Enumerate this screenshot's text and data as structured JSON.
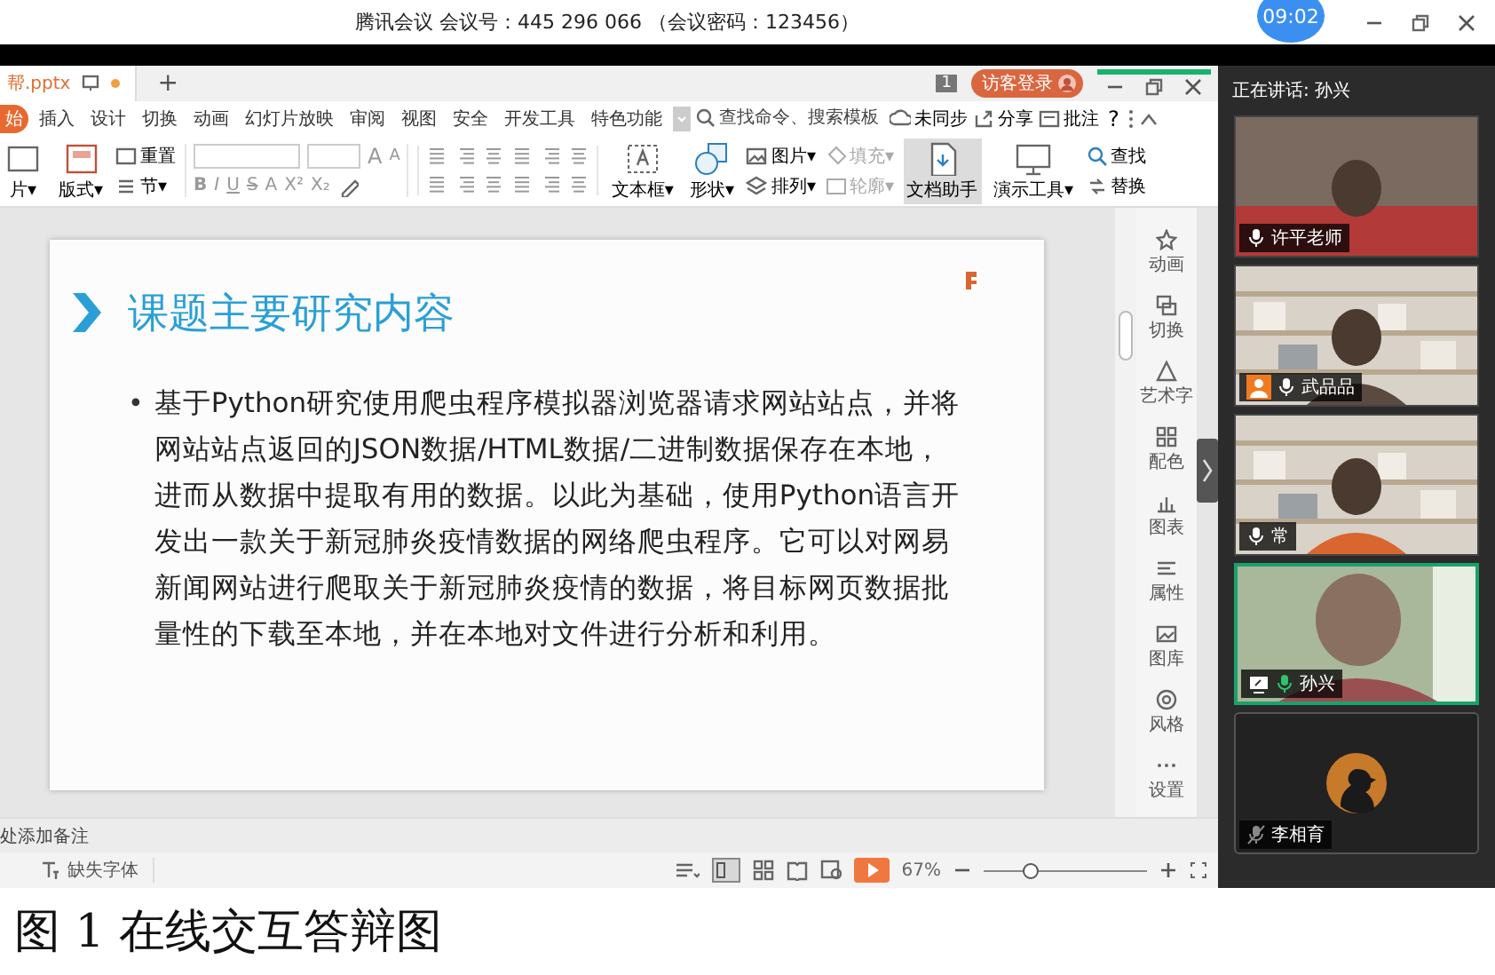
{
  "meeting_bar": {
    "title": "腾讯会议  会议号：445 296 066  （会议密码：123456）",
    "timer": "09:02"
  },
  "document_tabs": [
    {
      "label": "帮.pptx",
      "selected": true
    }
  ],
  "new_tab": "+",
  "page_count": "1",
  "login_button": "访客登录",
  "menu": [
    {
      "label": "始",
      "selected": true
    },
    {
      "label": "插入",
      "selected": false
    },
    {
      "label": "设计",
      "selected": false
    },
    {
      "label": "切换",
      "selected": false
    },
    {
      "label": "动画",
      "selected": false
    },
    {
      "label": "幻灯片放映",
      "selected": false
    },
    {
      "label": "审阅",
      "selected": false
    },
    {
      "label": "视图",
      "selected": false
    },
    {
      "label": "安全",
      "selected": false
    },
    {
      "label": "开发工具",
      "selected": false
    },
    {
      "label": "特色功能",
      "selected": false
    }
  ],
  "search": {
    "placeholder": "查找命令、搜索模板"
  },
  "menu_actions": [
    "未同步",
    "分享",
    "批注"
  ],
  "help": "?",
  "ribbon": [
    {
      "kind": "big",
      "label": "片▾",
      "selected": false
    },
    {
      "kind": "big",
      "label": "版式▾",
      "selected": false
    },
    {
      "kind": "stack",
      "items": [
        {
          "label": "重置",
          "disabled": false
        },
        {
          "label": "节▾",
          "disabled": false
        }
      ]
    },
    {
      "kind": "font",
      "size_buttons": [
        "A",
        "A"
      ],
      "format_buttons": [
        "B",
        "I",
        "U",
        "S",
        "A",
        "X²",
        "X₂"
      ]
    },
    {
      "kind": "paragraph"
    },
    {
      "kind": "big",
      "label": "文本框▾",
      "selected": false
    },
    {
      "kind": "big",
      "label": "形状▾",
      "selected": false
    },
    {
      "kind": "stack",
      "items": [
        {
          "label": "图片▾",
          "disabled": false
        },
        {
          "label": "排列▾",
          "disabled": false
        }
      ]
    },
    {
      "kind": "stack",
      "items": [
        {
          "label": "填充▾",
          "disabled": true
        },
        {
          "label": "轮廓▾",
          "disabled": true
        }
      ]
    },
    {
      "kind": "big",
      "label": "文档助手",
      "selected": true
    },
    {
      "kind": "big",
      "label": "演示工具▾",
      "selected": false
    },
    {
      "kind": "stack",
      "items": [
        {
          "label": "查找",
          "disabled": false
        },
        {
          "label": "替换",
          "disabled": false
        }
      ]
    }
  ],
  "slide": {
    "title": "课题主要研究内容",
    "bullet": "•",
    "body": "基于Python研究使用爬虫程序模拟器浏览器请求网站站点，并将网站站点返回的JSON数据/HTML数据/二进制数据保存在本地，进而从数据中提取有用的数据。以此为基础，使用Python语言开发出一款关于新冠肺炎疫情数据的网络爬虫程序。它可以对网易新闻网站进行爬取关于新冠肺炎疫情的数据，将目标网页数据批量性的下载至本地，并在本地对文件进行分析和利用。"
  },
  "side_tools": [
    "动画",
    "切换",
    "艺术字",
    "配色",
    "图表",
    "属性",
    "图库",
    "风格",
    "设置"
  ],
  "notes": "处添加备注",
  "status_bar": {
    "missing_fonts": "缺失字体",
    "zoom": "67%",
    "level": 0.28
  },
  "meeting_panel": {
    "speaking": "正在讲话: 孙兴",
    "participants": [
      {
        "name": "许平老师",
        "kind": "camera",
        "muted": false,
        "speaking": false,
        "sharing": false,
        "badge": false
      },
      {
        "name": "武品品",
        "kind": "camera",
        "muted": false,
        "speaking": false,
        "sharing": false,
        "badge": true
      },
      {
        "name": "常",
        "kind": "camera",
        "muted": false,
        "speaking": false,
        "sharing": false,
        "badge": false
      },
      {
        "name": "孙兴",
        "kind": "camera",
        "muted": false,
        "speaking": true,
        "sharing": true,
        "badge": false
      },
      {
        "name": "李相育",
        "kind": "avatar",
        "muted": true,
        "speaking": false,
        "sharing": false,
        "badge": false
      }
    ]
  },
  "caption": "图 1  在线交互答辩图"
}
